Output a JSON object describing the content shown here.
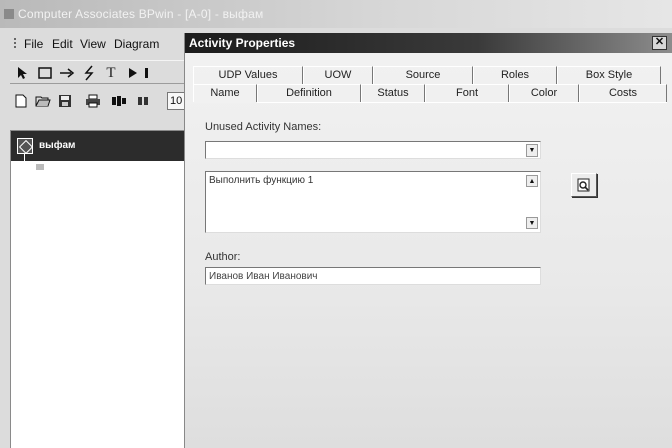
{
  "app": {
    "title": "Computer Associates BPwin - [A-0] - выфам"
  },
  "menu": {
    "items": [
      {
        "label": "File"
      },
      {
        "label": "Edit"
      },
      {
        "label": "View"
      },
      {
        "label": "Diagram"
      }
    ]
  },
  "toolbar": {
    "text_tool": "T",
    "zoom_value": "10"
  },
  "tree": {
    "root_label": "выфам"
  },
  "dialog": {
    "title": "Activity Properties",
    "close_label": "✕",
    "tabs_back": [
      "UDP Values",
      "UOW",
      "Source",
      "Roles",
      "Box Style"
    ],
    "tabs_front": [
      "Name",
      "Definition",
      "Status",
      "Font",
      "Color",
      "Costs"
    ],
    "active_tab": "Name",
    "unused_names_label": "Unused Activity Names:",
    "unused_names_value": "",
    "name_value": "Выполнить функцию 1",
    "author_label": "Author:",
    "author_value": "Иванов Иван Иванович"
  },
  "colors": {
    "dialog_title_bg": "#1c1c1c",
    "tree_header_bg": "#2c2c2c"
  }
}
